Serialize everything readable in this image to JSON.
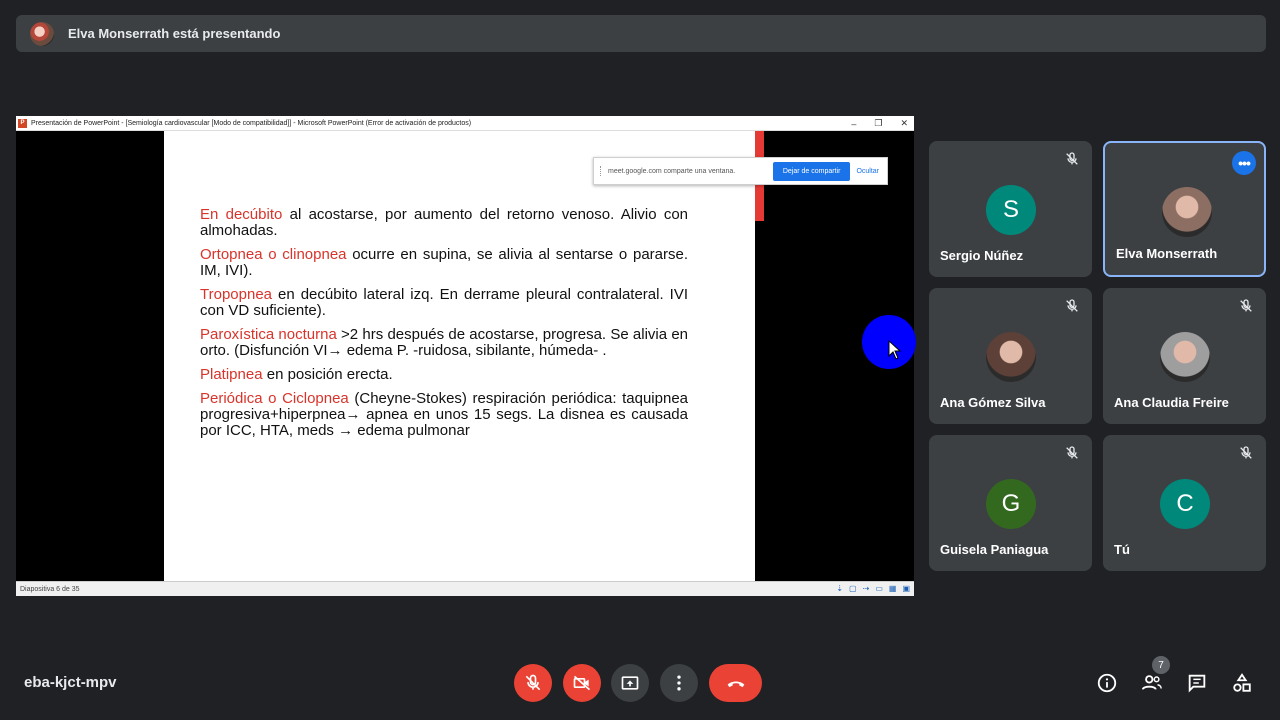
{
  "banner": {
    "text": "Elva Monserrath está presentando"
  },
  "shared_window": {
    "title": "Presentación de PowerPoint - [Semiología cardiovascular [Modo de compatibilidad]] - Microsoft PowerPoint (Error de activación de productos)",
    "app_icon": "P",
    "controls": {
      "minimize": "–",
      "restore": "❐",
      "close": "✕"
    },
    "share_popup": {
      "message": "meet.google.com comparte una ventana.",
      "stop_label": "Dejar de compartir",
      "hide_label": "Ocultar"
    },
    "status_bar": {
      "slide_indicator": "Diapositiva 6 de 35"
    },
    "slide": {
      "items": [
        {
          "term": "En decúbito",
          "text": " al acostarse, por aumento del retorno venoso. Alivio con almohadas."
        },
        {
          "term": "Ortopnea o clinopnea",
          "text": " ocurre en supina, se alivia al sentarse o pararse. IM, IVI)."
        },
        {
          "term": "Tropopnea",
          "text": " en decúbito lateral izq. En derrame pleural contralateral. IVI con VD suficiente)."
        },
        {
          "term": "Paroxística nocturna",
          "text": " >2 hrs después de acostarse, progresa. Se alivia en orto. (Disfunción VI→ edema P. -ruidosa, sibilante, húmeda- ."
        },
        {
          "term": "Platipnea",
          "text": " en posición erecta."
        },
        {
          "term": "Periódica o Ciclopnea",
          "text": " (Cheyne-Stokes) respiración periódica: taquipnea progresiva+hiperpnea→ apnea en unos 15 segs. La disnea es causada por ICC, HTA, meds → edema pulmonar"
        }
      ]
    }
  },
  "participants": [
    {
      "name": "Sergio Núñez",
      "initial": "S",
      "color": "#00897b",
      "muted": true,
      "avatar": "letter"
    },
    {
      "name": "Elva Monserrath",
      "initial": "",
      "color": "#8d6e63",
      "muted": false,
      "avatar": "photo"
    },
    {
      "name": "Ana Gómez Silva",
      "initial": "",
      "color": "#5d4037",
      "muted": true,
      "avatar": "photo"
    },
    {
      "name": "Ana Claudia Freire",
      "initial": "",
      "color": "#9e9e9e",
      "muted": true,
      "avatar": "photo"
    },
    {
      "name": "Guisela Paniagua",
      "initial": "G",
      "color": "#33691e",
      "muted": true,
      "avatar": "letter"
    },
    {
      "name": "Tú",
      "initial": "C",
      "color": "#00897b",
      "muted": true,
      "avatar": "letter"
    }
  ],
  "bottom_bar": {
    "meeting_code": "eba-kjct-mpv",
    "participant_count": "7",
    "icons": [
      "mic-off-icon",
      "camera-off-icon",
      "present-icon",
      "more-options-icon",
      "end-call-icon",
      "info-icon",
      "people-icon",
      "chat-icon",
      "activities-icon"
    ]
  },
  "colors": {
    "background": "#202124",
    "tile": "#3c4043",
    "danger": "#ea4335",
    "accent": "#1a73e8",
    "slide_highlight": "#d9342b"
  }
}
